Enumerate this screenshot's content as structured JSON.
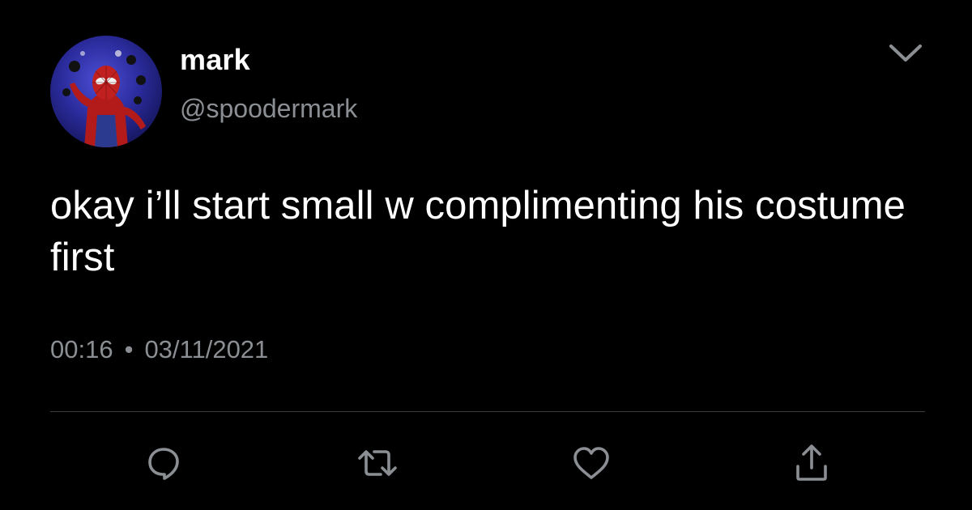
{
  "author": {
    "display_name": "mark",
    "handle": "@spoodermark",
    "avatar_icon": "spiderman-avatar-icon"
  },
  "tweet": {
    "text": "okay i’ll start small w complimenting his costume first",
    "time": "00:16",
    "separator": "•",
    "date": "03/11/2021"
  },
  "actions": [
    {
      "icon": "reply-icon"
    },
    {
      "icon": "retweet-icon"
    },
    {
      "icon": "like-icon"
    },
    {
      "icon": "share-icon"
    }
  ],
  "colors": {
    "background": "#000000",
    "text_primary": "#ffffff",
    "text_secondary": "#8b8f94",
    "divider": "#3a3d40",
    "icon": "#8b8f94"
  }
}
